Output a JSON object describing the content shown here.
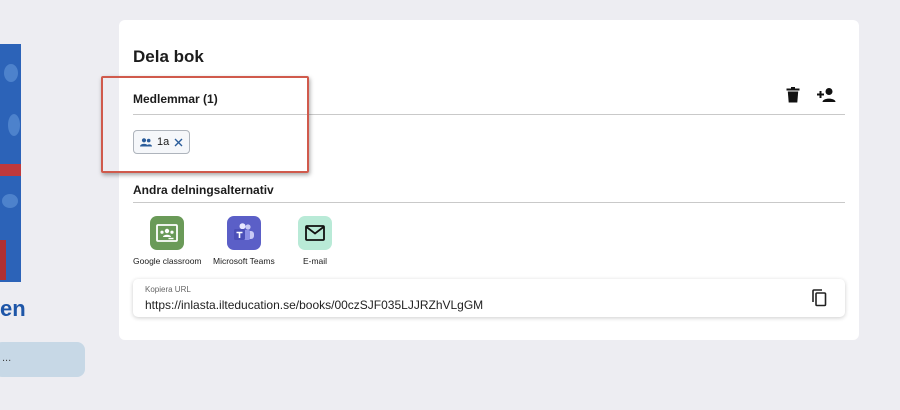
{
  "left_panel": {
    "title_fragment": "en",
    "pill_text": "..."
  },
  "share_dialog": {
    "title": "Dela bok",
    "members": {
      "heading": "Medlemmar (1)",
      "chips": [
        {
          "label": "1a",
          "icon": "group-icon"
        }
      ],
      "actions": [
        "delete-icon",
        "add-person-icon"
      ]
    },
    "other_options": {
      "heading": "Andra delningsalternativ",
      "items": [
        {
          "label": "Google classroom",
          "color": "#6a9a58",
          "icon": "google-classroom-icon"
        },
        {
          "label": "Microsoft Teams",
          "color": "#5b5fc7",
          "icon": "microsoft-teams-icon"
        },
        {
          "label": "E-mail",
          "color": "#b9ead7",
          "icon": "mail-icon"
        }
      ]
    },
    "copy_url": {
      "label": "Kopiera URL",
      "value": "https://inlasta.ilteducation.se/books/00czSJF035LJJRZhVLgGM",
      "icon": "copy-icon"
    }
  },
  "colors": {
    "background": "#ededf2",
    "card": "#ffffff",
    "highlight": "#d05a4c",
    "link_blue": "#1e56a8"
  }
}
